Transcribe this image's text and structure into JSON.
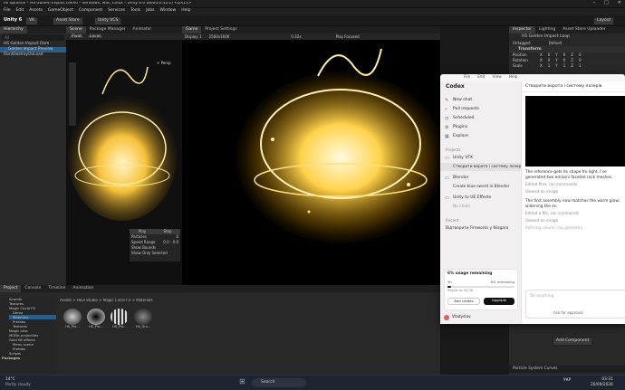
{
  "window": {
    "title": "All optional – HS Golden Impact Demo – Windows, Mac, Linux – Unity 6.0 (6000.0.41f1) <DX11>",
    "controls": [
      "–",
      "□",
      "✕"
    ]
  },
  "menu": [
    "File",
    "Edit",
    "Assets",
    "GameObject",
    "Component",
    "Services",
    "Tools",
    "Jobs",
    "Window",
    "Help"
  ],
  "toolbar": {
    "account": "Unity 6",
    "user": "VK",
    "asset_store": "Asset Store",
    "vcs": "Unity VCS",
    "layout": "Layout"
  },
  "hierarchy": {
    "tab": "Hierarchy",
    "search_placeholder": "All",
    "rows": [
      "HS Golden Impact Dem",
      "Golden Impact Preview",
      "DontDestroyOnLoad"
    ]
  },
  "scene": {
    "tabs": [
      "Scene",
      "Package Manager",
      "Animator"
    ],
    "pivot": "Pivot",
    "local": "Local",
    "persp": "< Persp",
    "overlay": {
      "header": [
        "Play",
        "Stop"
      ],
      "rows": [
        [
          "Particles",
          "0"
        ],
        [
          "Speed Range",
          "0.0 - 0.0"
        ],
        [
          "Show Bounds",
          ""
        ],
        [
          "Show Only Selected",
          ""
        ]
      ]
    }
  },
  "game": {
    "tabs": [
      "Game",
      "Project Settings"
    ],
    "display": "Display 1",
    "resolution": "2560x1600",
    "scale": "0.32x",
    "play_focused": "Play Focused"
  },
  "inspector": {
    "tabs": [
      "Inspector",
      "Lighting",
      "Asset Store Uploader"
    ],
    "object": "HS Golden Impact Loop",
    "tag": "Untagged",
    "layer": "Default",
    "transform": "Transform",
    "fields": [
      [
        "Position",
        "X",
        "0",
        "Y",
        "0",
        "Z",
        "0"
      ],
      [
        "Rotation",
        "X",
        "0",
        "Y",
        "0",
        "Z",
        "0"
      ],
      [
        "Scale",
        "X",
        "1",
        "Y",
        "1",
        "Z",
        "1"
      ]
    ],
    "add_component": "Add Component",
    "curves": "Particle System Curves"
  },
  "project": {
    "tabs": [
      "Project",
      "Console",
      "Timeline",
      "Animation"
    ],
    "breadcrumb": "Assets > Hovl Studio > Magic Circle FX > Materials",
    "tree": [
      "Sounds",
      "Textures",
      "Magic Circle FX",
      "Demo",
      "Materials",
      "Prefabs",
      "Textures",
      "Magic orbs",
      "MOBA projectiles",
      "Gold lift effects",
      "Menu scene",
      "Prefabs",
      "Scripts",
      "Packages"
    ],
    "assets": [
      "HS_Pre...",
      "HS_Pro...",
      "HS_Pro...",
      "HS_Gro..."
    ]
  },
  "codex": {
    "menu": [
      "File",
      "Edit",
      "View",
      "Help"
    ],
    "title": "Codex",
    "nav": [
      "New chat",
      "Pull requests",
      "Scheduled",
      "Plugins",
      "Explore"
    ],
    "projects_label": "Projects",
    "projects": [
      {
        "name": "Unity VFX",
        "threads": [
          "Створити ворота і систему лазерів"
        ]
      },
      {
        "name": "Blender",
        "threads": [
          "Create blue sword in Blender"
        ]
      },
      {
        "name": "Unity to UE Effects",
        "threads": [
          "No chats"
        ]
      }
    ],
    "recent_label": "Recent",
    "recent": [
      "Відтворити Fireworks у Niagara"
    ],
    "usage": {
      "title": "6% usage remaining",
      "window": "5h",
      "pct": "6% remaining",
      "resets": "Resets at 04:38",
      "add": "Add credits",
      "upgrade": "Upgrade",
      "pct_value": 0.06
    },
    "user": "Vladyslav",
    "thread_title": "Створити ворота і систему лазерів",
    "messages": [
      "The reference gets its shape fro light, I've generated two emissiv faceted rock meshes.",
      "The first assembly now matches the warm glow; widening the en"
    ],
    "meta": [
      "Edited files, ran commands",
      "Viewed an image",
      "Edited a file, ran commands",
      "Viewed an image",
      "Refining column ray geometry"
    ],
    "composer_placeholder": "Do anything",
    "approval": "Ask for approval"
  },
  "taskbar": {
    "weather_temp": "14°C",
    "weather_text": "Partly cloudy",
    "search": "Search",
    "lang": "УКР",
    "time": "03:31",
    "date": "20/09/2026"
  }
}
